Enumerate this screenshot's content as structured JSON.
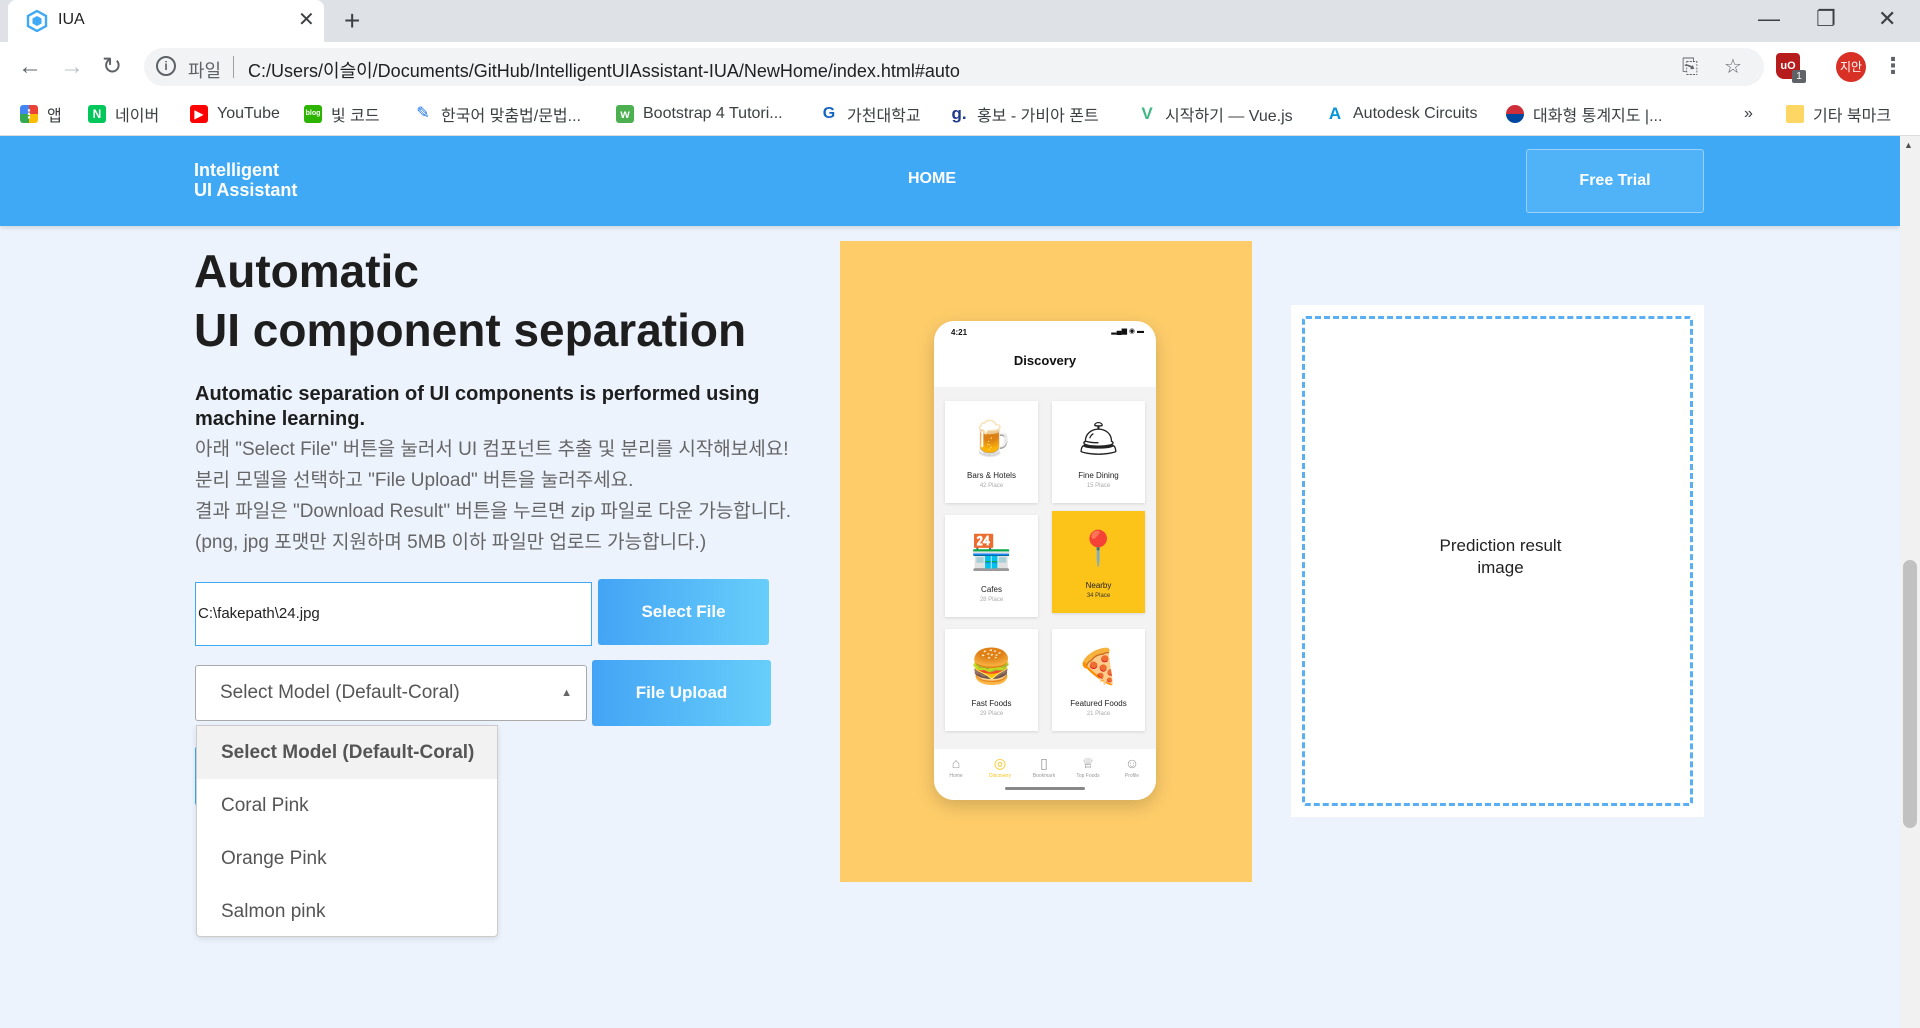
{
  "browser": {
    "tab_title": "IUA",
    "tab_close": "✕",
    "new_tab": "+",
    "window_controls": {
      "minimize": "—",
      "restore": "❐",
      "close": "✕"
    },
    "url_scheme": "파일",
    "url": "C:/Users/이슬이/Documents/GitHub/IntelligentUIAssistant-IUA/NewHome/index.html#auto",
    "extension_badge": "1",
    "profile_name": "지안",
    "bookmarks": [
      {
        "label": "앱",
        "icon": "apps-grid-icon",
        "color": "#ea4335"
      },
      {
        "label": "네이버",
        "icon": "naver-icon",
        "color": "#03c75a"
      },
      {
        "label": "YouTube",
        "icon": "youtube-icon",
        "color": "#ff0000"
      },
      {
        "label": "빛 코드",
        "icon": "blog-icon",
        "color": "#2db400"
      },
      {
        "label": "한국어 맞춤법/문법...",
        "icon": "speller-icon",
        "color": "#1a73e8"
      },
      {
        "label": "Bootstrap 4 Tutori...",
        "icon": "w3schools-icon",
        "color": "#4caf50"
      },
      {
        "label": "가천대학교",
        "icon": "gachon-icon",
        "color": "#1565c0"
      },
      {
        "label": "홍보 - 가비아 폰트",
        "icon": "gabia-icon",
        "color": "#1e3a8a"
      },
      {
        "label": "시작하기 — Vue.js",
        "icon": "vue-icon",
        "color": "#41b883"
      },
      {
        "label": "Autodesk Circuits",
        "icon": "autodesk-icon",
        "color": "#0696d7"
      },
      {
        "label": "대화형 통계지도 |...",
        "icon": "korea-flag-icon",
        "color": "#cd2e3a"
      }
    ],
    "bookmarks_overflow": "»",
    "other_bookmarks": "기타 북마크"
  },
  "site": {
    "logo_line1": "Intelligent",
    "logo_line2": "UI Assistant",
    "nav_home": "HOME",
    "trial_button": "Free Trial",
    "headline_line1": "Automatic",
    "headline_line2": "UI component separation",
    "subhead": "Automatic separation of UI components is performed using machine learning.",
    "desc_lines": [
      "아래 \"Select File\" 버튼을 눌러서 UI 컴포넌트 추출 및 분리를 시작해보세요!",
      "분리 모델을 선택하고 \"File Upload\" 버튼을 눌러주세요.",
      "결과 파일은 \"Download Result\" 버튼을 누르면 zip 파일로 다운 가능합니다.",
      "(png, jpg 포맷만 지원하며 5MB 이하 파일만 업로드 가능합니다.)"
    ],
    "file_path": "C:\\fakepath\\24.jpg",
    "select_file_button": "Select File",
    "model_select_value": "Select Model (Default-Coral)",
    "upload_button": "File Upload",
    "model_options": [
      "Select Model (Default-Coral)",
      "Coral Pink",
      "Orange Pink",
      "Salmon pink"
    ],
    "prediction_line1": "Prediction result",
    "prediction_line2": "image",
    "colors": {
      "primary": "#3fa9f5",
      "page_bg": "#ecf3fd",
      "mock_bg": "#fecd6a",
      "accent_yellow": "#fcc419"
    }
  },
  "phone": {
    "time": "4:21",
    "status": "▂▄▆ ◉ ▬",
    "title": "Discovery",
    "cards": [
      {
        "name": "Bars  & Hotels",
        "count": "42 Place",
        "icon": "beer-mug-icon",
        "glyph": "🍺"
      },
      {
        "name": "Fine Dining",
        "count": "15 Place",
        "icon": "cloche-icon",
        "glyph": "🛎"
      },
      {
        "name": "Cafes",
        "count": "28 Place",
        "icon": "cafe-store-icon",
        "glyph": "🏪"
      },
      {
        "name": "Nearby",
        "count": "34 Place",
        "icon": "map-pin-icon",
        "glyph": "📍"
      },
      {
        "name": "Fast Foods",
        "count": "29 Place",
        "icon": "burger-icon",
        "glyph": "🍔"
      },
      {
        "name": "Featured Foods",
        "count": "21 Place",
        "icon": "pizza-icon",
        "glyph": "🍕"
      }
    ],
    "tabs": [
      {
        "label": "Home",
        "icon": "home-icon",
        "glyph": "⌂"
      },
      {
        "label": "Discovery",
        "icon": "location-icon",
        "glyph": "◎"
      },
      {
        "label": "Bookmark",
        "icon": "bookmark-icon",
        "glyph": "▯"
      },
      {
        "label": "Top Foods",
        "icon": "trophy-icon",
        "glyph": "♕"
      },
      {
        "label": "Profile",
        "icon": "user-icon",
        "glyph": "☺"
      }
    ]
  }
}
